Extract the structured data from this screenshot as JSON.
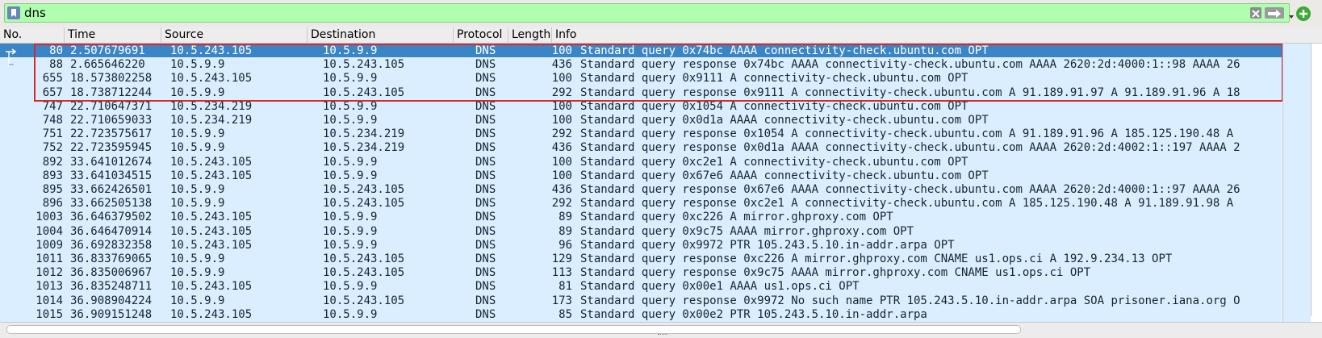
{
  "filter": {
    "value": "dns",
    "icons": [
      "bookmark-icon",
      "clear-icon",
      "arrow-right-icon",
      "chevron-down-icon",
      "plus-icon"
    ]
  },
  "columns": [
    "No.",
    "Time",
    "Source",
    "Destination",
    "Protocol",
    "Length",
    "Info"
  ],
  "rows": [
    {
      "no": "80",
      "time": "2.507679691",
      "src": "10.5.243.105",
      "dst": "10.5.9.9",
      "proto": "DNS",
      "len": "100",
      "info": "Standard query 0x74bc AAAA connectivity-check.ubuntu.com OPT"
    },
    {
      "no": "88",
      "time": "2.665646220",
      "src": "10.5.9.9",
      "dst": "10.5.243.105",
      "proto": "DNS",
      "len": "436",
      "info": "Standard query response 0x74bc AAAA connectivity-check.ubuntu.com AAAA 2620:2d:4000:1::98 AAAA 26"
    },
    {
      "no": "655",
      "time": "18.573802258",
      "src": "10.5.243.105",
      "dst": "10.5.9.9",
      "proto": "DNS",
      "len": "100",
      "info": "Standard query 0x9111 A connectivity-check.ubuntu.com OPT"
    },
    {
      "no": "657",
      "time": "18.738712244",
      "src": "10.5.9.9",
      "dst": "10.5.243.105",
      "proto": "DNS",
      "len": "292",
      "info": "Standard query response 0x9111 A connectivity-check.ubuntu.com A 91.189.91.97 A 91.189.91.96 A 18"
    },
    {
      "no": "747",
      "time": "22.710647371",
      "src": "10.5.234.219",
      "dst": "10.5.9.9",
      "proto": "DNS",
      "len": "100",
      "info": "Standard query 0x1054 A connectivity-check.ubuntu.com OPT"
    },
    {
      "no": "748",
      "time": "22.710659033",
      "src": "10.5.234.219",
      "dst": "10.5.9.9",
      "proto": "DNS",
      "len": "100",
      "info": "Standard query 0x0d1a AAAA connectivity-check.ubuntu.com OPT"
    },
    {
      "no": "751",
      "time": "22.723575617",
      "src": "10.5.9.9",
      "dst": "10.5.234.219",
      "proto": "DNS",
      "len": "292",
      "info": "Standard query response 0x1054 A connectivity-check.ubuntu.com A 91.189.91.96 A 185.125.190.48 A"
    },
    {
      "no": "752",
      "time": "22.723595945",
      "src": "10.5.9.9",
      "dst": "10.5.234.219",
      "proto": "DNS",
      "len": "436",
      "info": "Standard query response 0x0d1a AAAA connectivity-check.ubuntu.com AAAA 2620:2d:4002:1::197 AAAA 2"
    },
    {
      "no": "892",
      "time": "33.641012674",
      "src": "10.5.243.105",
      "dst": "10.5.9.9",
      "proto": "DNS",
      "len": "100",
      "info": "Standard query 0xc2e1 A connectivity-check.ubuntu.com OPT"
    },
    {
      "no": "893",
      "time": "33.641034515",
      "src": "10.5.243.105",
      "dst": "10.5.9.9",
      "proto": "DNS",
      "len": "100",
      "info": "Standard query 0x67e6 AAAA connectivity-check.ubuntu.com OPT"
    },
    {
      "no": "895",
      "time": "33.662426501",
      "src": "10.5.9.9",
      "dst": "10.5.243.105",
      "proto": "DNS",
      "len": "436",
      "info": "Standard query response 0x67e6 AAAA connectivity-check.ubuntu.com AAAA 2620:2d:4000:1::97 AAAA 26"
    },
    {
      "no": "896",
      "time": "33.662505138",
      "src": "10.5.9.9",
      "dst": "10.5.243.105",
      "proto": "DNS",
      "len": "292",
      "info": "Standard query response 0xc2e1 A connectivity-check.ubuntu.com A 185.125.190.48 A 91.189.91.98 A"
    },
    {
      "no": "1003",
      "time": "36.646379502",
      "src": "10.5.243.105",
      "dst": "10.5.9.9",
      "proto": "DNS",
      "len": "89",
      "info": "Standard query 0xc226 A mirror.ghproxy.com OPT"
    },
    {
      "no": "1004",
      "time": "36.646470914",
      "src": "10.5.243.105",
      "dst": "10.5.9.9",
      "proto": "DNS",
      "len": "89",
      "info": "Standard query 0x9c75 AAAA mirror.ghproxy.com OPT"
    },
    {
      "no": "1009",
      "time": "36.692832358",
      "src": "10.5.243.105",
      "dst": "10.5.9.9",
      "proto": "DNS",
      "len": "96",
      "info": "Standard query 0x9972 PTR 105.243.5.10.in-addr.arpa OPT"
    },
    {
      "no": "1011",
      "time": "36.833769065",
      "src": "10.5.9.9",
      "dst": "10.5.243.105",
      "proto": "DNS",
      "len": "129",
      "info": "Standard query response 0xc226 A mirror.ghproxy.com CNAME us1.ops.ci A 192.9.234.13 OPT"
    },
    {
      "no": "1012",
      "time": "36.835006967",
      "src": "10.5.9.9",
      "dst": "10.5.243.105",
      "proto": "DNS",
      "len": "113",
      "info": "Standard query response 0x9c75 AAAA mirror.ghproxy.com CNAME us1.ops.ci OPT"
    },
    {
      "no": "1013",
      "time": "36.835248711",
      "src": "10.5.243.105",
      "dst": "10.5.9.9",
      "proto": "DNS",
      "len": "81",
      "info": "Standard query 0x00e1 AAAA us1.ops.ci OPT"
    },
    {
      "no": "1014",
      "time": "36.908904224",
      "src": "10.5.9.9",
      "dst": "10.5.243.105",
      "proto": "DNS",
      "len": "173",
      "info": "Standard query response 0x9972 No such name PTR 105.243.5.10.in-addr.arpa SOA prisoner.iana.org O"
    },
    {
      "no": "1015",
      "time": "36.909151248",
      "src": "10.5.243.105",
      "dst": "10.5.9.9",
      "proto": "DNS",
      "len": "85",
      "info": "Standard query 0x00e2 PTR 105.243.5.10.in-addr.arpa"
    }
  ],
  "selected_row": 0,
  "colors": {
    "filter_bg": "#afffaf",
    "row_bg": "#daeeff",
    "selected_bg": "#3a85c6",
    "highlight_border": "#d8282b"
  }
}
